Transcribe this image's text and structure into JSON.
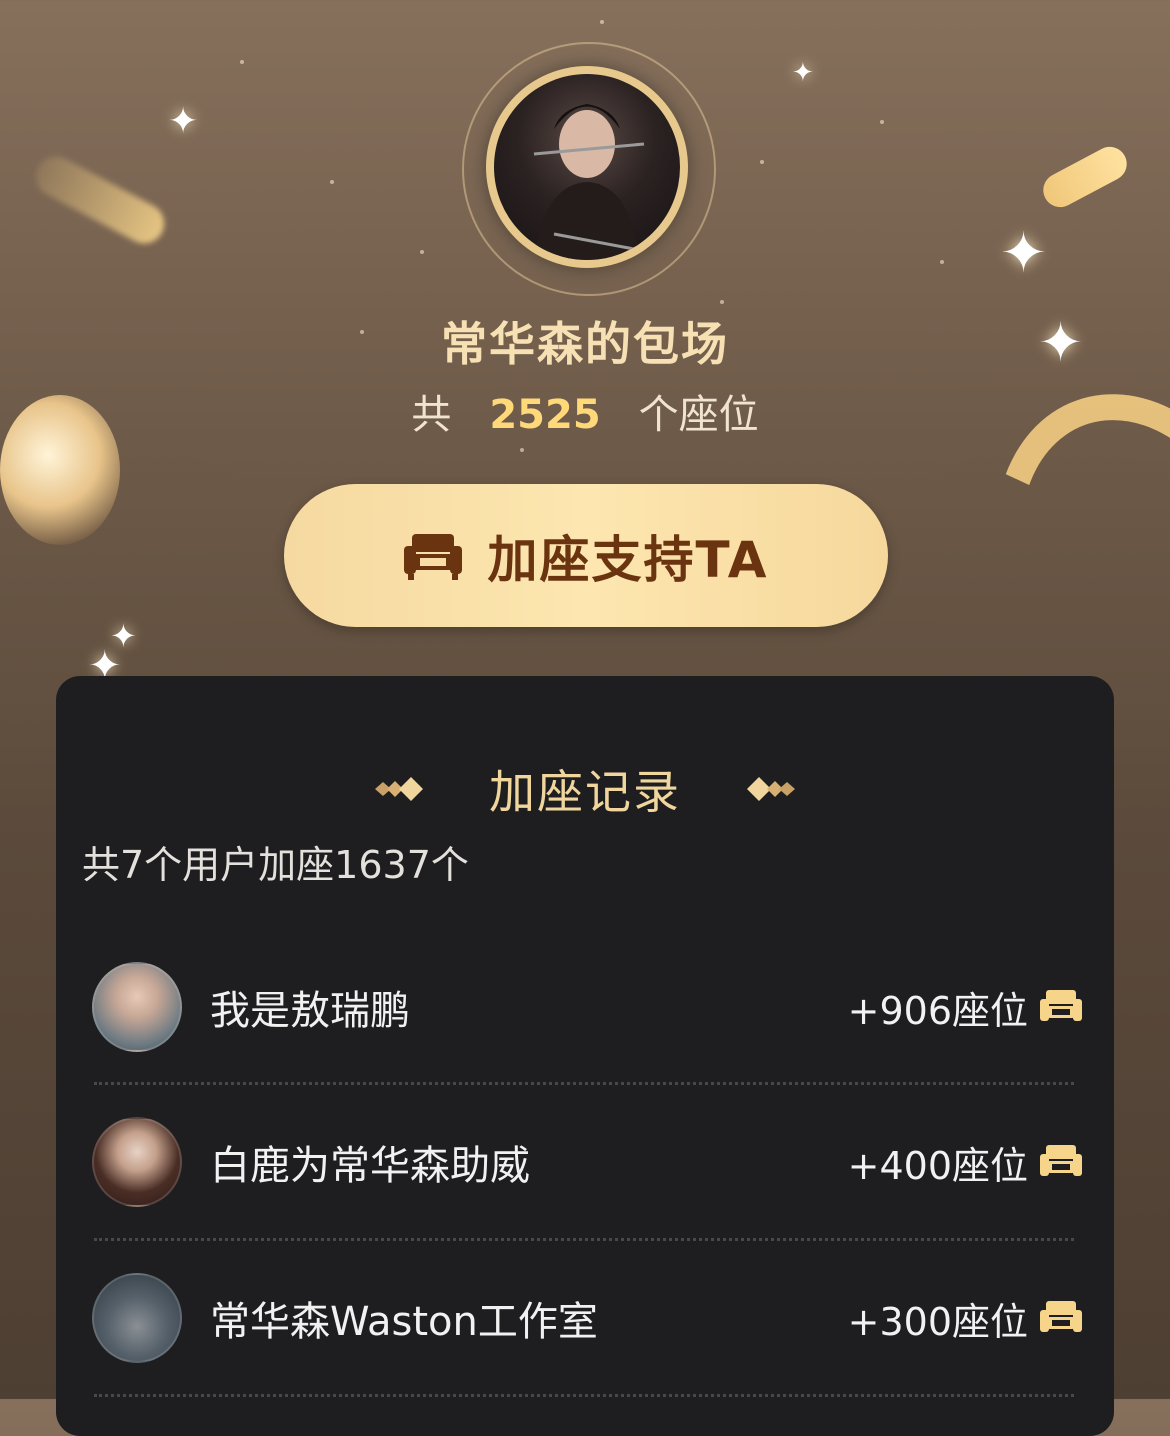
{
  "page": {
    "title": "常华森的包场",
    "count_prefix": "共",
    "seat_count": "2525",
    "count_suffix": "个座位"
  },
  "support_button": {
    "label": "加座支持TA",
    "icon": "sofa-icon"
  },
  "record": {
    "title": "加座记录",
    "summary": "共7个用户加座1637个",
    "items": [
      {
        "name": "我是敖瑞鹏",
        "value": "+906座位",
        "icon": "sofa-icon"
      },
      {
        "name": "白鹿为常华森助威",
        "value": "+400座位",
        "icon": "sofa-icon"
      },
      {
        "name": "常华森Waston工作室",
        "value": "+300座位",
        "icon": "sofa-icon"
      }
    ]
  },
  "colors": {
    "accent_gold": "#ffd879",
    "button_text": "#6a3410",
    "panel_bg": "#1e1e21"
  }
}
